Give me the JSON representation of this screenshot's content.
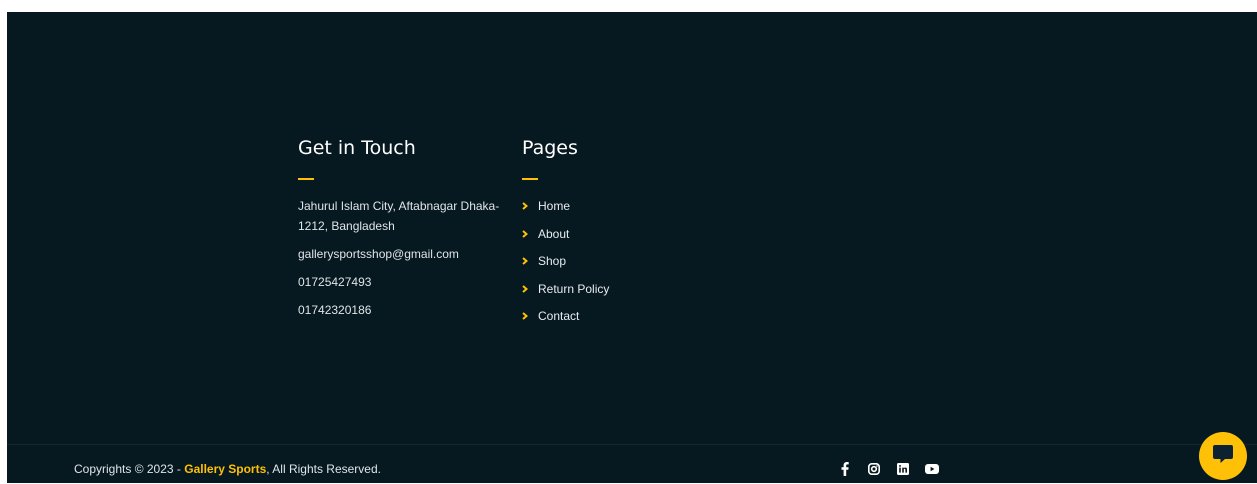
{
  "contact": {
    "heading": "Get in Touch",
    "address_line1": "Jahurul Islam City, Aftabnagar Dhaka-",
    "address_line2": "1212, Bangladesh",
    "email": "gallerysportsshop@gmail.com",
    "phone1": "01725427493",
    "phone2": "01742320186"
  },
  "pages": {
    "heading": "Pages",
    "items": [
      {
        "label": "Home"
      },
      {
        "label": "About"
      },
      {
        "label": "Shop"
      },
      {
        "label": "Return Policy"
      },
      {
        "label": "Contact"
      }
    ]
  },
  "footer": {
    "copyright_prefix": "Copyrights © 2023 - ",
    "brand": "Gallery Sports",
    "copyright_suffix": ", All Rights Reserved."
  },
  "social": {
    "icons": [
      "facebook-icon",
      "instagram-icon",
      "linkedin-icon",
      "youtube-icon"
    ]
  },
  "colors": {
    "background": "#061820",
    "accent": "#ffc107",
    "text": "#dfe5e8"
  }
}
